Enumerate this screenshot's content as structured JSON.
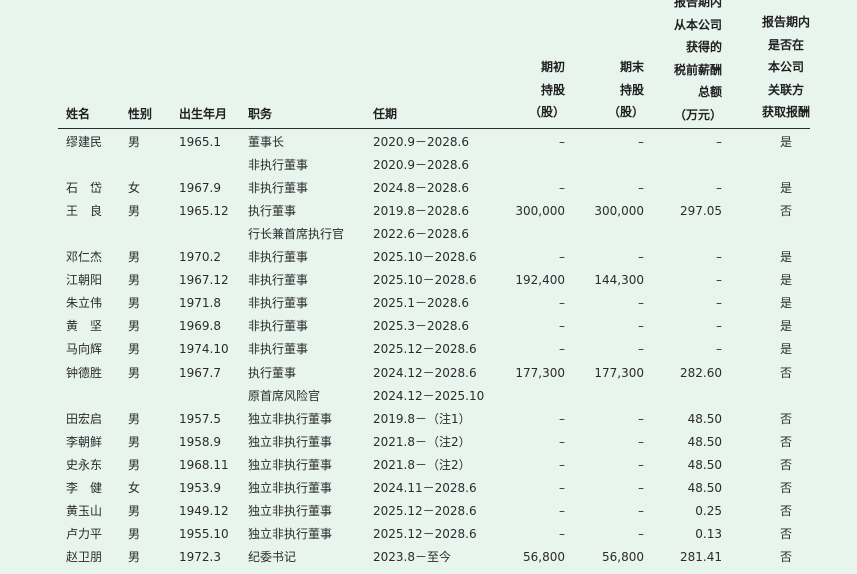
{
  "headers": {
    "name": "姓名",
    "gender": "性别",
    "birth": "出生年月",
    "position": "职务",
    "term": "任期",
    "open_shares": [
      "期初",
      "持股",
      "（股）"
    ],
    "close_shares": [
      "期末",
      "持股",
      "（股）"
    ],
    "pay": [
      "报告期内",
      "从本公司",
      "获得的",
      "税前薪酬",
      "总额",
      "（万元）"
    ],
    "related": [
      "报告期内",
      "是否在",
      "本公司",
      "关联方",
      "获取报酬"
    ]
  },
  "rows": [
    {
      "name": "缪建民",
      "gender": "男",
      "birth": "1965.1",
      "position": "董事长",
      "term": "2020.9－2028.6",
      "open": "–",
      "close": "–",
      "pay": "–",
      "related": "是"
    },
    {
      "name": "",
      "gender": "",
      "birth": "",
      "position": "非执行董事",
      "term": "2020.9－2028.6",
      "open": "",
      "close": "",
      "pay": "",
      "related": ""
    },
    {
      "name": "石　岱",
      "gender": "女",
      "birth": "1967.9",
      "position": "非执行董事",
      "term": "2024.8－2028.6",
      "open": "–",
      "close": "–",
      "pay": "–",
      "related": "是"
    },
    {
      "name": "王　良",
      "gender": "男",
      "birth": "1965.12",
      "position": "执行董事",
      "term": "2019.8－2028.6",
      "open": "300,000",
      "close": "300,000",
      "pay": "297.05",
      "related": "否"
    },
    {
      "name": "",
      "gender": "",
      "birth": "",
      "position": "行长兼首席执行官",
      "term": "2022.6－2028.6",
      "open": "",
      "close": "",
      "pay": "",
      "related": ""
    },
    {
      "name": "邓仁杰",
      "gender": "男",
      "birth": "1970.2",
      "position": "非执行董事",
      "term": "2025.10－2028.6",
      "open": "–",
      "close": "–",
      "pay": "–",
      "related": "是"
    },
    {
      "name": "江朝阳",
      "gender": "男",
      "birth": "1967.12",
      "position": "非执行董事",
      "term": "2025.10－2028.6",
      "open": "192,400",
      "close": "144,300",
      "pay": "–",
      "related": "是"
    },
    {
      "name": "朱立伟",
      "gender": "男",
      "birth": "1971.8",
      "position": "非执行董事",
      "term": "2025.1－2028.6",
      "open": "–",
      "close": "–",
      "pay": "–",
      "related": "是"
    },
    {
      "name": "黄　坚",
      "gender": "男",
      "birth": "1969.8",
      "position": "非执行董事",
      "term": "2025.3－2028.6",
      "open": "–",
      "close": "–",
      "pay": "–",
      "related": "是"
    },
    {
      "name": "马向辉",
      "gender": "男",
      "birth": "1974.10",
      "position": "非执行董事",
      "term": "2025.12－2028.6",
      "open": "–",
      "close": "–",
      "pay": "–",
      "related": "是"
    },
    {
      "name": "钟德胜",
      "gender": "男",
      "birth": "1967.7",
      "position": "执行董事",
      "term": "2024.12－2028.6",
      "open": "177,300",
      "close": "177,300",
      "pay": "282.60",
      "related": "否"
    },
    {
      "name": "",
      "gender": "",
      "birth": "",
      "position": "原首席风险官",
      "term": "2024.12－2025.10",
      "open": "",
      "close": "",
      "pay": "",
      "related": ""
    },
    {
      "name": "田宏启",
      "gender": "男",
      "birth": "1957.5",
      "position": "独立非执行董事",
      "term": "2019.8－（注1）",
      "open": "–",
      "close": "–",
      "pay": "48.50",
      "related": "否"
    },
    {
      "name": "李朝鲜",
      "gender": "男",
      "birth": "1958.9",
      "position": "独立非执行董事",
      "term": "2021.8－（注2）",
      "open": "–",
      "close": "–",
      "pay": "48.50",
      "related": "否"
    },
    {
      "name": "史永东",
      "gender": "男",
      "birth": "1968.11",
      "position": "独立非执行董事",
      "term": "2021.8－（注2）",
      "open": "–",
      "close": "–",
      "pay": "48.50",
      "related": "否"
    },
    {
      "name": "李　健",
      "gender": "女",
      "birth": "1953.9",
      "position": "独立非执行董事",
      "term": "2024.11－2028.6",
      "open": "–",
      "close": "–",
      "pay": "48.50",
      "related": "否"
    },
    {
      "name": "黄玉山",
      "gender": "男",
      "birth": "1949.12",
      "position": "独立非执行董事",
      "term": "2025.12－2028.6",
      "open": "–",
      "close": "–",
      "pay": "0.25",
      "related": "否"
    },
    {
      "name": "卢力平",
      "gender": "男",
      "birth": "1955.10",
      "position": "独立非执行董事",
      "term": "2025.12－2028.6",
      "open": "–",
      "close": "–",
      "pay": "0.13",
      "related": "否"
    },
    {
      "name": "赵卫朋",
      "gender": "男",
      "birth": "1972.3",
      "position": "纪委书记",
      "term": "2023.8－至今",
      "open": "56,800",
      "close": "56,800",
      "pay": "281.41",
      "related": "否"
    }
  ]
}
